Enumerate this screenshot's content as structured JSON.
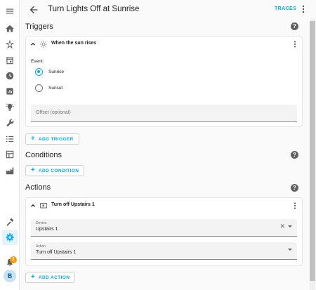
{
  "header": {
    "title": "Turn Lights Off at Sunrise",
    "traces_label": "TRACES"
  },
  "sidebar": {
    "items": [
      {
        "icon": "menu-icon"
      },
      {
        "icon": "home-icon"
      },
      {
        "icon": "energy-icon"
      },
      {
        "icon": "calendar-icon"
      },
      {
        "icon": "history-icon"
      },
      {
        "icon": "logbook-icon"
      },
      {
        "icon": "bulb-icon"
      },
      {
        "icon": "wrench-icon"
      },
      {
        "icon": "todo-list-icon"
      },
      {
        "icon": "media-icon"
      },
      {
        "icon": "factory-icon"
      },
      {
        "icon": "hammer-icon"
      },
      {
        "icon": "gear-icon",
        "active": true
      },
      {
        "icon": "bell-icon"
      }
    ],
    "notification_count": "1",
    "avatar_letter": "B"
  },
  "triggers": {
    "title": "Triggers",
    "card": {
      "label": "When the sun rises",
      "event_label": "Event:",
      "options": [
        {
          "label": "Sunrise",
          "selected": true
        },
        {
          "label": "Sunset",
          "selected": false
        }
      ],
      "offset_placeholder": "Offset (optional)"
    },
    "add_label": "ADD TRIGGER"
  },
  "conditions": {
    "title": "Conditions",
    "add_label": "ADD CONDITION"
  },
  "actions": {
    "title": "Actions",
    "card": {
      "label": "Turn off Upstairs 1",
      "device_field_label": "Device",
      "device_value": "Upstairs 1",
      "action_field_label": "Action",
      "action_value": "Turn off Upstairs 1"
    },
    "add_label": "ADD ACTION"
  },
  "colors": {
    "accent": "#03a9f4",
    "notification_badge": "#ff9800",
    "help_icon": "#616161"
  }
}
